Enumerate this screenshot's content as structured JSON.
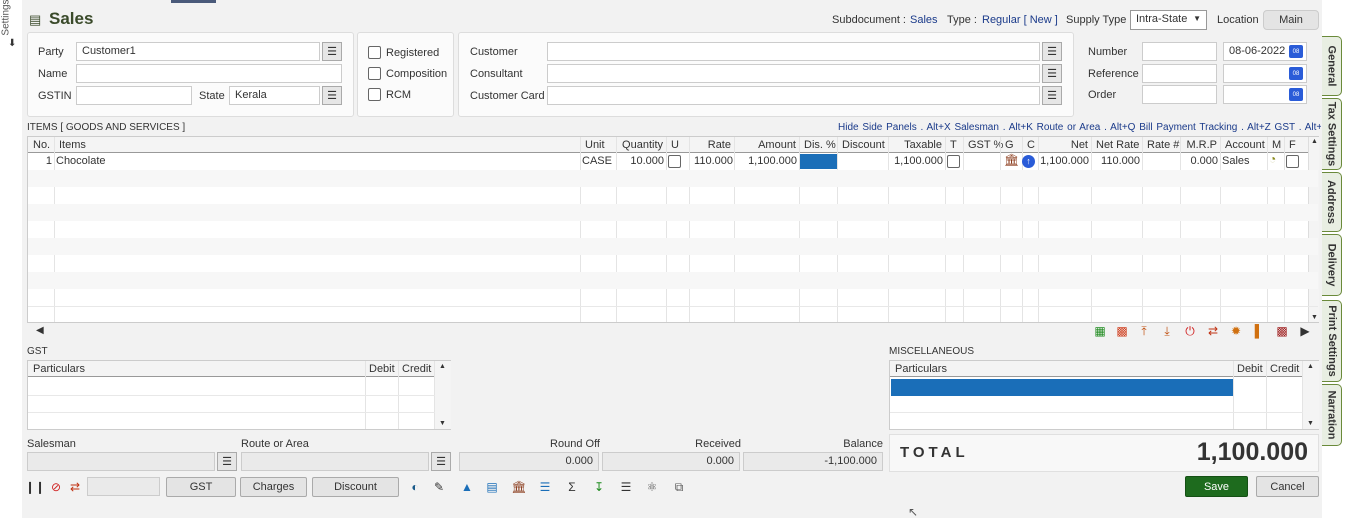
{
  "header": {
    "title": "Sales",
    "subdocument_label": "Subdocument :",
    "subdocument_value": "Sales",
    "type_label": "Type :",
    "type_value": "Regular [ New ]",
    "supply_label": "Supply Type",
    "supply_value": "Intra-State",
    "location_label": "Location",
    "location_value": "Main",
    "settings_label": "Settings"
  },
  "party": {
    "party_label": "Party",
    "party_value": "Customer1",
    "name_label": "Name",
    "name_value": "",
    "gstin_label": "GSTIN",
    "gstin_value": "",
    "state_label": "State",
    "state_value": "Kerala"
  },
  "flags": {
    "registered": "Registered",
    "composition": "Composition",
    "rcm": "RCM"
  },
  "customer": {
    "customer_label": "Customer",
    "consultant_label": "Consultant",
    "card_label": "Customer Card"
  },
  "doc": {
    "number_label": "Number",
    "number_value": "",
    "date_value": "08-06-2022",
    "reference_label": "Reference",
    "order_label": "Order",
    "cal_label": "08"
  },
  "items": {
    "section_title": "ITEMS [ GOODS AND SERVICES ]",
    "shortcuts": "Hide Side Panels . Alt+X   Salesman . Alt+K   Route or Area . Alt+Q   Bill Payment Tracking . Alt+Z   GST . Alt+F",
    "columns": [
      "No.",
      "Items",
      "Unit",
      "Quantity",
      "U",
      "Rate",
      "Amount",
      "Dis. %",
      "Discount",
      "Taxable",
      "T",
      "GST %",
      "G",
      "C",
      "Net",
      "Net Rate",
      "Rate #",
      "M.R.P",
      "Account",
      "M",
      "F"
    ],
    "row": {
      "no": "1",
      "item": "Chocolate",
      "unit": "CASE",
      "quantity": "10.000",
      "rate": "110.000",
      "amount": "1,100.000",
      "taxable": "1,100.000",
      "net": "1,100.000",
      "net_rate": "110.000",
      "mrp": "0.000",
      "account": "Sales"
    }
  },
  "gst": {
    "title": "GST",
    "col_particulars": "Particulars",
    "col_debit": "Debit",
    "col_credit": "Credit"
  },
  "misc": {
    "title": "MISCELLANEOUS",
    "col_particulars": "Particulars",
    "col_debit": "Debit",
    "col_credit": "Credit"
  },
  "footer": {
    "salesman_label": "Salesman",
    "route_label": "Route or Area",
    "roundoff_label": "Round Off",
    "roundoff_value": "0.000",
    "received_label": "Received",
    "received_value": "0.000",
    "balance_label": "Balance",
    "balance_value": "-1,100.000",
    "total_label": "TOTAL",
    "total_value": "1,100.000"
  },
  "buttons": {
    "gst": "GST",
    "charges": "Charges",
    "discount": "Discount",
    "save": "Save",
    "cancel": "Cancel"
  },
  "side_tabs": [
    "General",
    "Tax Settings",
    "Address",
    "Delivery",
    "Print Settings",
    "Narration"
  ],
  "colors": {
    "accent_green": "#1e6b1e",
    "selection_blue": "#1a6eb8",
    "tab_border": "#6a8a3a"
  }
}
